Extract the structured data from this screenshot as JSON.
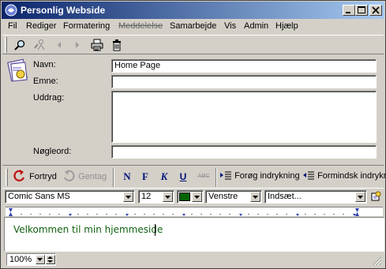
{
  "window": {
    "title": "Personlig Webside"
  },
  "menu": [
    "Fil",
    "Rediger",
    "Formatering",
    "Meddelelse",
    "Samarbejde",
    "Vis",
    "Admin",
    "Hjælp"
  ],
  "form": {
    "name_label": "Navn:",
    "name_value": "Home Page",
    "subject_label": "Emne:",
    "subject_value": "",
    "excerpt_label": "Uddrag:",
    "excerpt_value": "",
    "keywords_label": "Nøgleord:",
    "keywords_value": ""
  },
  "editbar": {
    "undo": "Fortryd",
    "redo": "Gentag",
    "bold_n": "N",
    "bold_f": "F",
    "italic_k": "K",
    "underline_u": "U",
    "strike": "ABC",
    "indent_more": "Forøg indrykning",
    "indent_less": "Formindsk indrykning"
  },
  "formatbar": {
    "font": "Comic Sans MS",
    "size": "12",
    "color": "#006400",
    "align": "Venstre",
    "insert": "Indsæt..."
  },
  "editor": {
    "content": "Velkommen til min hjemmeside"
  },
  "status": {
    "zoom": "100%"
  },
  "colors": {
    "title_start": "#0a246a",
    "title_end": "#a6caf0",
    "text_green": "#106010"
  },
  "icons": [
    "app-icon",
    "search-icon",
    "people-icon",
    "back-arrow-icon",
    "forward-arrow-icon",
    "print-icon",
    "trash-icon",
    "document-icon",
    "undo-icon",
    "redo-icon",
    "indent-more-icon",
    "indent-less-icon",
    "insert-object-icon"
  ]
}
